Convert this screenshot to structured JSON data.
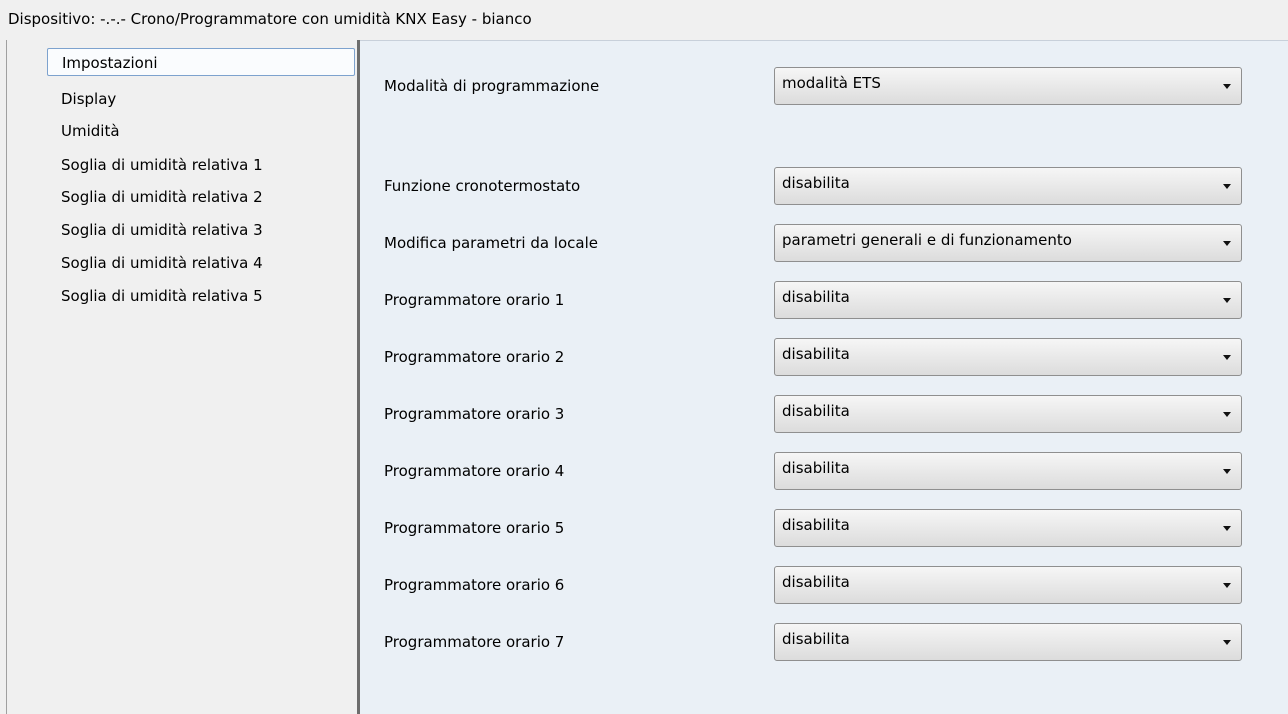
{
  "title": "Dispositivo: -.-.-  Crono/Programmatore con umidità KNX Easy - bianco",
  "sidebar": {
    "items": [
      {
        "label": "Impostazioni",
        "selected": true
      },
      {
        "label": "Display"
      },
      {
        "label": "Umidità"
      },
      {
        "label": "Soglia di umidità relativa 1"
      },
      {
        "label": "Soglia di umidità relativa 2"
      },
      {
        "label": "Soglia di umidità relativa 3"
      },
      {
        "label": "Soglia di umidità relativa 4"
      },
      {
        "label": "Soglia di umidità relativa 5"
      }
    ]
  },
  "params": [
    {
      "label": "Modalità di programmazione",
      "value": "modalità ETS"
    },
    {
      "label": "Funzione cronotermostato",
      "value": "disabilita"
    },
    {
      "label": "Modifica parametri da locale",
      "value": "parametri generali e di funzionamento"
    },
    {
      "label": "Programmatore orario 1",
      "value": "disabilita"
    },
    {
      "label": "Programmatore orario 2",
      "value": "disabilita"
    },
    {
      "label": "Programmatore orario 3",
      "value": "disabilita"
    },
    {
      "label": "Programmatore orario 4",
      "value": "disabilita"
    },
    {
      "label": "Programmatore orario 5",
      "value": "disabilita"
    },
    {
      "label": "Programmatore orario 6",
      "value": "disabilita"
    },
    {
      "label": "Programmatore orario 7",
      "value": "disabilita"
    }
  ],
  "colors": {
    "main_background": "#eaf0f6",
    "selection_border": "#7da2ce",
    "splitter": "#6d6d6d"
  }
}
